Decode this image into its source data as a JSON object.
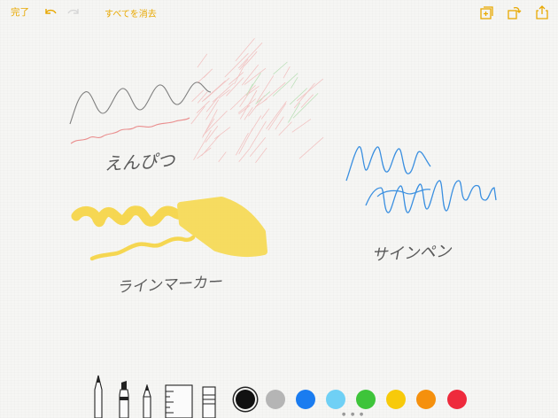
{
  "header": {
    "done_label": "完了",
    "clear_all_label": "すべてを消去",
    "accent_color": "#e8a800"
  },
  "icons": {
    "undo": "undo-icon",
    "redo": "redo-icon",
    "add_page": "add-page-icon",
    "rotate": "rotate-icon",
    "share": "share-icon"
  },
  "annotations": {
    "pencil": "えんぴつ",
    "marker": "ラインマーカー",
    "sign_pen": "サインペン"
  },
  "tools": [
    {
      "name": "pen",
      "icon": "pen-icon"
    },
    {
      "name": "marker",
      "icon": "marker-icon"
    },
    {
      "name": "pencil",
      "icon": "pencil-icon"
    },
    {
      "name": "ruler",
      "icon": "ruler-icon"
    },
    {
      "name": "eraser",
      "icon": "eraser-icon"
    }
  ],
  "colors": [
    {
      "name": "black",
      "hex": "#111111",
      "selected": true
    },
    {
      "name": "gray",
      "hex": "#b5b5b5",
      "selected": false
    },
    {
      "name": "blue",
      "hex": "#1a7cf0",
      "selected": false
    },
    {
      "name": "light-blue",
      "hex": "#6fd0f5",
      "selected": false
    },
    {
      "name": "green",
      "hex": "#3ec43a",
      "selected": false
    },
    {
      "name": "yellow",
      "hex": "#f7ca0a",
      "selected": false
    },
    {
      "name": "orange",
      "hex": "#f5900d",
      "selected": false
    },
    {
      "name": "red",
      "hex": "#ee2a3c",
      "selected": false
    }
  ]
}
